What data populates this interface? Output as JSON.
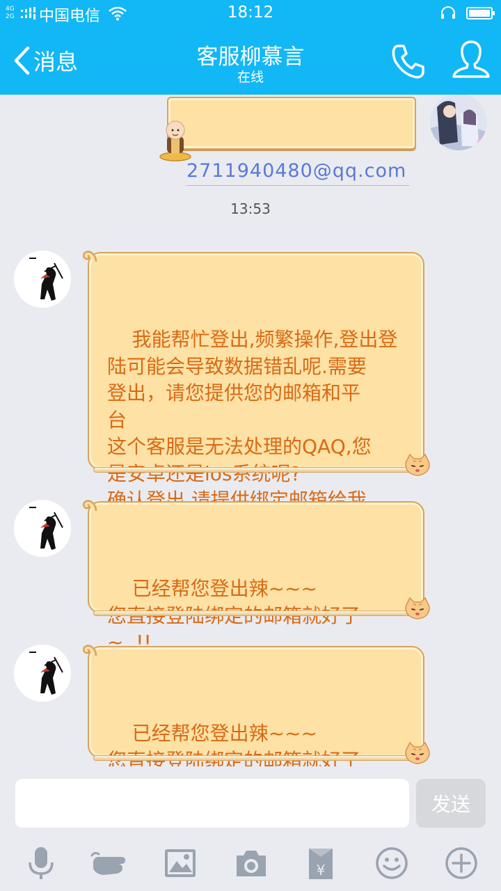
{
  "status_bar": {
    "network_top": "4G",
    "network_bottom": "2G",
    "carrier": "中国电信",
    "time": "18:12"
  },
  "header": {
    "back_label": "消息",
    "title": "客服柳慕言",
    "subtitle": "在线"
  },
  "messages": {
    "email": "2711940480@qq.com",
    "timestamp": "13:53",
    "items": [
      {
        "text": "我能帮忙登出,频繁操作,登出登\n陆可能会导致数据错乱呢.需要\n登出，请您提供您的邮箱和平\n台\n这个客服是无法处理的QAQ,您\n是安卓还是ios系统呢?\n确认登出,请提供绑定邮箱给我"
      },
      {
        "text": "已经帮您登出辣~~~\n您直接登陆绑定的邮箱就好了\n~..!!"
      },
      {
        "text": "已经帮您登出辣~~~\n您直接登陆绑定的邮箱就好了\n~..!!"
      }
    ]
  },
  "input": {
    "value": "",
    "send_label": "发送"
  },
  "icons": {
    "header": [
      "back-chevron-icon",
      "phone-icon",
      "profile-icon"
    ],
    "toolbar": [
      "microphone-icon",
      "poke-hand-icon",
      "image-icon",
      "camera-icon",
      "red-packet-icon",
      "emoji-icon",
      "plus-icon"
    ]
  },
  "colors": {
    "header_bg": "#12b7f5",
    "bubble_bg": "#fde1a5",
    "bubble_text": "#d96a15",
    "email_link": "#5a78d8",
    "chat_bg": "#eaebf0",
    "toolbar_icon": "#9aa3b0"
  }
}
